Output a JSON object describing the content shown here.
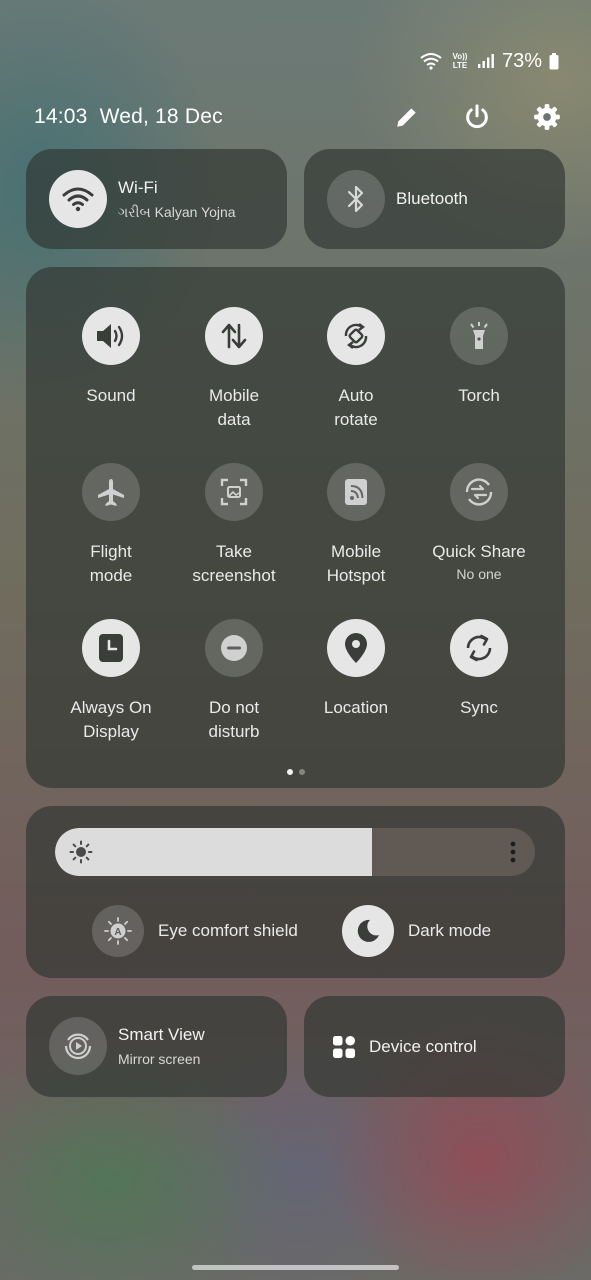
{
  "status": {
    "battery_pct": "73%"
  },
  "header": {
    "time": "14:03",
    "date": "Wed, 18 Dec"
  },
  "wifi": {
    "label": "Wi-Fi",
    "network": "ગરીબ Kalyan Yojna"
  },
  "bluetooth": {
    "label": "Bluetooth"
  },
  "tiles": [
    {
      "label": "Sound",
      "icon": "sound-icon",
      "active": true
    },
    {
      "label": "Mobile\ndata",
      "icon": "mobile-data-icon",
      "active": true
    },
    {
      "label": "Auto\nrotate",
      "icon": "auto-rotate-icon",
      "active": true
    },
    {
      "label": "Torch",
      "icon": "torch-icon",
      "active": false
    },
    {
      "label": "Flight\nmode",
      "icon": "airplane-icon",
      "active": false
    },
    {
      "label": "Take\nscreenshot",
      "icon": "screenshot-icon",
      "active": false
    },
    {
      "label": "Mobile\nHotspot",
      "icon": "hotspot-icon",
      "active": false
    },
    {
      "label": "Quick Share",
      "sub": "No one",
      "icon": "quick-share-icon",
      "active": false
    },
    {
      "label": "Always On\nDisplay",
      "icon": "always-on-display-icon",
      "active": true
    },
    {
      "label": "Do not\ndisturb",
      "icon": "do-not-disturb-icon",
      "active": false
    },
    {
      "label": "Location",
      "icon": "location-icon",
      "active": true
    },
    {
      "label": "Sync",
      "icon": "sync-icon",
      "active": true
    }
  ],
  "pager": {
    "pages": 2,
    "current": 1
  },
  "brightness": {
    "level": 0.66
  },
  "eye_comfort": {
    "label": "Eye comfort shield"
  },
  "dark_mode": {
    "label": "Dark mode"
  },
  "smart_view": {
    "label": "Smart View",
    "sub": "Mirror screen"
  },
  "device_control": {
    "label": "Device control"
  },
  "colors": {
    "active_bg": "#e6e6e6",
    "icon_dark": "#3a3d3a",
    "card_bg": "#303732"
  }
}
